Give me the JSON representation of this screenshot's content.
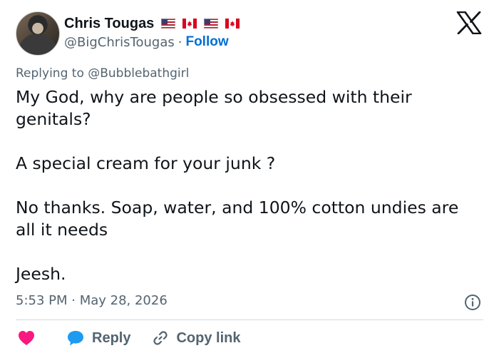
{
  "author": {
    "name": "Chris Tougas",
    "handle": "@BigChrisTougas",
    "separator": "·",
    "follow_label": "Follow"
  },
  "flags": [
    "us-flag-icon",
    "canada-flag-icon",
    "us-flag-icon",
    "canada-flag-icon"
  ],
  "reply_context": "Replying to @Bubblebathgirl",
  "tweet": {
    "paragraphs": [
      "My God, why are people so obsessed with their genitals?",
      "A special cream for your junk ?",
      "No thanks. Soap, water, and 100% cotton undies are all it needs",
      "Jeesh."
    ]
  },
  "timestamp": "5:53 PM · May 28, 2026",
  "actions": {
    "reply_label": "Reply",
    "copy_link_label": "Copy link"
  },
  "colors": {
    "text": "#0f1419",
    "muted": "#536471",
    "follow": "#006fd6",
    "heart": "#f91880",
    "reply_bubble": "#1d9bf0",
    "divider": "#cfd9de"
  }
}
